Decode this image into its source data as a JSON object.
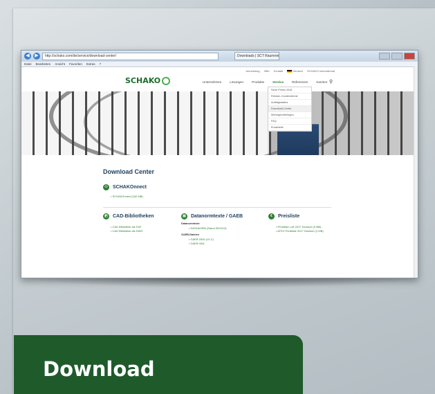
{
  "browser": {
    "address": "http://schako.com/de/service/download-center/",
    "tab_title": "Downloads | SCT Raumrein...",
    "menu": [
      "Datei",
      "Bearbeiten",
      "Ansicht",
      "Favoriten",
      "Extras",
      "?"
    ]
  },
  "site": {
    "topbar": [
      "Anmeldung",
      "Hilfe",
      "Kontakt",
      "Deutsch",
      "SCHAKO International"
    ],
    "logo": "SCHAKO",
    "nav": [
      "Unternehmen",
      "Lösungen",
      "Produkte",
      "Service",
      "Referenzen",
      "Karriere"
    ],
    "nav_active": "Service",
    "dropdown": [
      "Neue Preise 2018",
      "Reklam.-Kundendienst",
      "Auftragsstatus",
      "Download-Center",
      "Montageunterlagen",
      "FAQ",
      "Ersatzteile"
    ]
  },
  "content": {
    "title": "Download Center",
    "schakonnect": {
      "heading": "SCHAKOnnect",
      "items": [
        "SCHAKOnnect (182 MB)"
      ]
    },
    "cad": {
      "heading": "CAD-Bibliotheken",
      "items": [
        "CAD Bibliothek als DXF",
        "CAD Bibliothek als DWG"
      ]
    },
    "gaeb": {
      "heading": "Datanormtexte / GAEB",
      "sub1": "Datanormtexte",
      "items1": [
        "DATANORM (Stand 09/2013)"
      ],
      "sub2": "GAEB-Dateien",
      "items2": [
        "GAEB 2000 (V1.2)",
        "GAEB XML"
      ]
    },
    "preis": {
      "heading": "Preisliste",
      "items": [
        "Preisliste Luft 2017 Deutsch (5 MB)",
        "ATEX Preisliste 2017 Deutsch (1 MB)"
      ]
    }
  },
  "banner": {
    "label": "Download"
  }
}
